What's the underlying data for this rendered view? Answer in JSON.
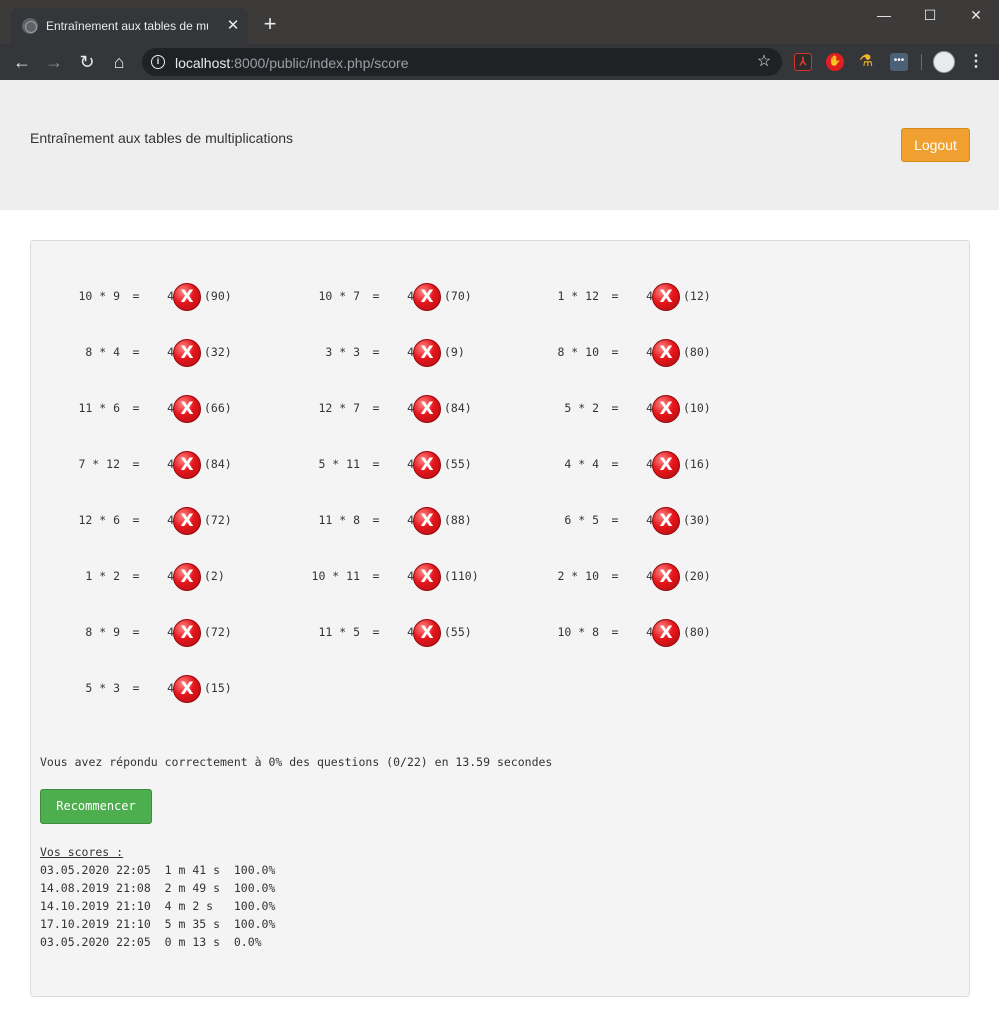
{
  "browser": {
    "tab_title": "Entraînement aux tables de multiplications",
    "tab_close": "✕",
    "new_tab": "+",
    "url_host": "localhost",
    "url_rest": ":8000/public/index.php/score",
    "minimize": "—",
    "maximize": "☐",
    "close": "✕",
    "back": "←",
    "forward": "→",
    "reload": "↻",
    "home": "⌂",
    "star": "☆",
    "menu": "⋮"
  },
  "header": {
    "title": "Entraînement aux tables de multiplications",
    "logout_label": "Logout"
  },
  "colors": {
    "logout": "#f0a030",
    "restart": "#4cae4c",
    "wrong": "#e5161b"
  },
  "questions": [
    {
      "expr": "10 * 9",
      "eq": "=",
      "answer": "4",
      "mark": "X",
      "correct": "(90)"
    },
    {
      "expr": "10 * 7",
      "eq": "=",
      "answer": "4",
      "mark": "X",
      "correct": "(70)"
    },
    {
      "expr": "1 * 12",
      "eq": "=",
      "answer": "4",
      "mark": "X",
      "correct": "(12)"
    },
    {
      "expr": "8 * 4",
      "eq": "=",
      "answer": "4",
      "mark": "X",
      "correct": "(32)"
    },
    {
      "expr": "3 * 3",
      "eq": "=",
      "answer": "4",
      "mark": "X",
      "correct": "(9)"
    },
    {
      "expr": "8 * 10",
      "eq": "=",
      "answer": "4",
      "mark": "X",
      "correct": "(80)"
    },
    {
      "expr": "11 * 6",
      "eq": "=",
      "answer": "4",
      "mark": "X",
      "correct": "(66)"
    },
    {
      "expr": "12 * 7",
      "eq": "=",
      "answer": "4",
      "mark": "X",
      "correct": "(84)"
    },
    {
      "expr": "5 * 2",
      "eq": "=",
      "answer": "4",
      "mark": "X",
      "correct": "(10)"
    },
    {
      "expr": "7 * 12",
      "eq": "=",
      "answer": "4",
      "mark": "X",
      "correct": "(84)"
    },
    {
      "expr": "5 * 11",
      "eq": "=",
      "answer": "4",
      "mark": "X",
      "correct": "(55)"
    },
    {
      "expr": "4 * 4",
      "eq": "=",
      "answer": "4",
      "mark": "X",
      "correct": "(16)"
    },
    {
      "expr": "12 * 6",
      "eq": "=",
      "answer": "4",
      "mark": "X",
      "correct": "(72)"
    },
    {
      "expr": "11 * 8",
      "eq": "=",
      "answer": "4",
      "mark": "X",
      "correct": "(88)"
    },
    {
      "expr": "6 * 5",
      "eq": "=",
      "answer": "4",
      "mark": "X",
      "correct": "(30)"
    },
    {
      "expr": "1 * 2",
      "eq": "=",
      "answer": "4",
      "mark": "X",
      "correct": "(2)"
    },
    {
      "expr": "10 * 11",
      "eq": "=",
      "answer": "4",
      "mark": "X",
      "correct": "(110)"
    },
    {
      "expr": "2 * 10",
      "eq": "=",
      "answer": "4",
      "mark": "X",
      "correct": "(20)"
    },
    {
      "expr": "8 * 9",
      "eq": "=",
      "answer": "4",
      "mark": "X",
      "correct": "(72)"
    },
    {
      "expr": "11 * 5",
      "eq": "=",
      "answer": "4",
      "mark": "X",
      "correct": "(55)"
    },
    {
      "expr": "10 * 8",
      "eq": "=",
      "answer": "4",
      "mark": "X",
      "correct": "(80)"
    },
    {
      "expr": "5 * 3",
      "eq": "=",
      "answer": "4",
      "mark": "X",
      "correct": "(15)"
    }
  ],
  "result": {
    "text": "Vous avez répondu correctement à 0% des questions (0/22) en 13.59 secondes",
    "restart_label": "Recommencer"
  },
  "scores": {
    "title": "Vos scores :",
    "rows": [
      "03.05.2020 22:05  1 m 41 s  100.0%",
      "14.08.2019 21:08  2 m 49 s  100.0%",
      "14.10.2019 21:10  4 m 2 s   100.0%",
      "17.10.2019 21:10  5 m 35 s  100.0%",
      "03.05.2020 22:05  0 m 13 s  0.0%"
    ]
  }
}
